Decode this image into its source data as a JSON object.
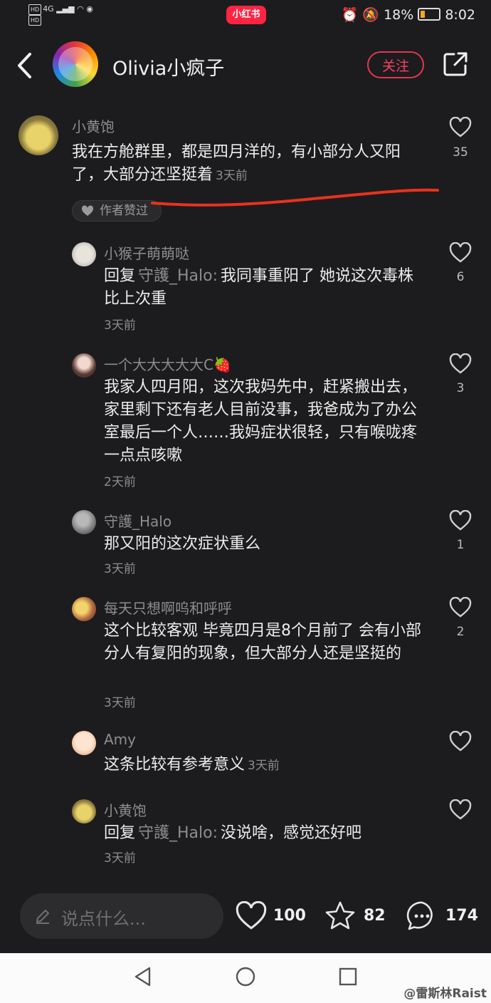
{
  "status_bar": {
    "network_label": "4G",
    "hd_label": "HD",
    "app_badge": "小红书",
    "battery": "18%",
    "time": "8:02"
  },
  "header": {
    "author_name": "Olivia小疯子",
    "follow_label": "关注"
  },
  "comments": [
    {
      "user": "小黄饱",
      "text": "我在方舱群里，都是四月洋的，有小部分人又阳了，大部分还坚挺着",
      "time": "3天前",
      "likes": "35",
      "badge": "作者赞过"
    },
    {
      "user": "小猴子萌萌哒",
      "reply_prefix": "回复",
      "reply_to": "守護_Halo:",
      "text": "我同事重阳了 她说这次毒株比上次重",
      "time": "3天前",
      "likes": "6"
    },
    {
      "user": "一个大大大大大C🍓",
      "text": "我家人四月阳，这次我妈先中，赶紧搬出去，家里剩下还有老人目前没事，我爸成为了办公室最后一个人……我妈症状很轻，只有喉咙疼一点点咳嗽",
      "time": "2天前",
      "likes": "3"
    },
    {
      "user": "守護_Halo",
      "text": "那又阳的这次症状重么",
      "time": "3天前",
      "likes": "1"
    },
    {
      "user": "每天只想啊呜和呼呼",
      "text": "这个比较客观 毕竟四月是8个月前了 会有小部分人有复阳的现象，但大部分人还是坚挺的",
      "time": "3天前",
      "likes": "2"
    },
    {
      "user": "Amy",
      "text": "这条比较有参考意义",
      "time": "3天前",
      "likes": ""
    },
    {
      "user": "小黄饱",
      "reply_prefix": "回复",
      "reply_to": "守護_Halo:",
      "text": "没说啥，感觉还好吧",
      "time": "3天前",
      "likes": ""
    }
  ],
  "bottom_bar": {
    "input_placeholder": "说点什么...",
    "likes": "100",
    "collects": "82",
    "comments": "174"
  },
  "watermark": "@雷斯林Raist",
  "colors": {
    "background": "#1c1c1e",
    "accent": "#ff2442",
    "annotation_line": "#e8321e"
  }
}
